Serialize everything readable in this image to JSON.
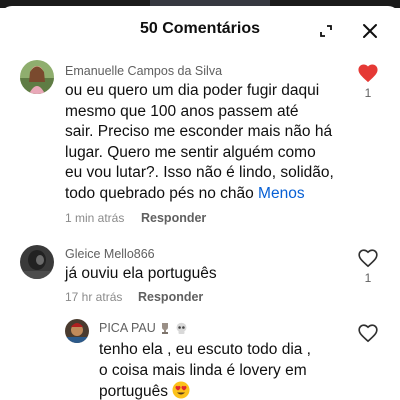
{
  "header": {
    "title": "50 Comentários"
  },
  "comments": [
    {
      "author": "Emanuelle Campos da Silva",
      "text_lines": [
        "ou eu quero um dia poder fugir daqui",
        "mesmo que 100 anos passem até",
        "sair. Preciso me esconder mais não há",
        "lugar. Quero me sentir alguém como",
        "eu vou lutar?. Isso não é lindo, solidão,",
        "todo quebrado pés no chão "
      ],
      "less_label": "Menos",
      "time": "1 min atrás",
      "reply_label": "Responder",
      "liked": true,
      "like_count": "1",
      "like_color": "#e53935"
    },
    {
      "author": "Gleice Mello866",
      "text_lines": [
        "já ouviu ela português"
      ],
      "time": "17 hr atrás",
      "reply_label": "Responder",
      "liked": false,
      "like_count": "1"
    }
  ],
  "reply": {
    "author": "PICA PAU",
    "author_emojis": [
      "trophy-icon",
      "skull-icon"
    ],
    "text_lines": [
      "tenho ela , eu escuto todo dia ,",
      "o coisa mais linda é lovery em",
      "português "
    ],
    "text_emoji": "heart-eyes-emoji",
    "liked": false
  },
  "colors": {
    "link": "#065fd4",
    "like_active": "#e53935",
    "secondary_text": "#606060"
  }
}
